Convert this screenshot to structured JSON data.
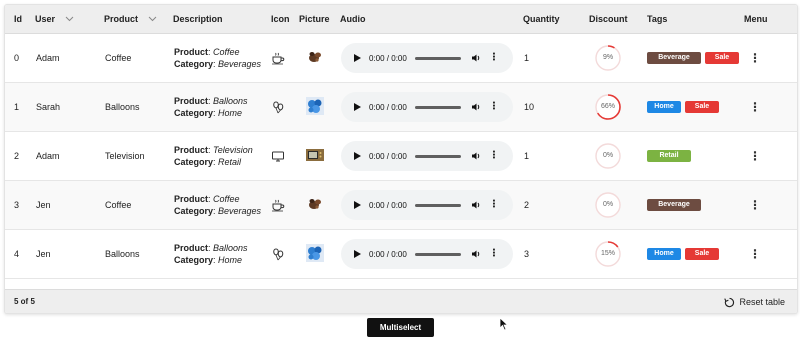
{
  "headers": {
    "id": "Id",
    "user": "User",
    "product": "Product",
    "description": "Description",
    "icon": "Icon",
    "picture": "Picture",
    "audio": "Audio",
    "quantity": "Quantity",
    "discount": "Discount",
    "tags": "Tags",
    "menu": "Menu"
  },
  "desc_labels": {
    "product": "Product",
    "category": "Category"
  },
  "rows": [
    {
      "id": "0",
      "user": "Adam",
      "product": "Coffee",
      "desc_product": "Coffee",
      "desc_category": "Beverages",
      "icon": "coffee-cup-icon",
      "audio_time": "0:00 / 0:00",
      "quantity": "1",
      "discount": 0.09,
      "discount_label": "9%",
      "tags": [
        {
          "label": "Beverage",
          "color": "#6d4c41"
        },
        {
          "label": "Sale",
          "color": "#e53935"
        }
      ]
    },
    {
      "id": "1",
      "user": "Sarah",
      "product": "Balloons",
      "desc_product": "Balloons",
      "desc_category": "Home",
      "icon": "balloons-icon",
      "audio_time": "0:00 / 0:00",
      "quantity": "10",
      "discount": 0.66,
      "discount_label": "66%",
      "tags": [
        {
          "label": "Home",
          "color": "#1e88e5"
        },
        {
          "label": "Sale",
          "color": "#e53935"
        }
      ]
    },
    {
      "id": "2",
      "user": "Adam",
      "product": "Television",
      "desc_product": "Television",
      "desc_category": "Retail",
      "icon": "television-icon",
      "audio_time": "0:00 / 0:00",
      "quantity": "1",
      "discount": 0,
      "discount_label": "0%",
      "tags": [
        {
          "label": "Retail",
          "color": "#7cb342"
        }
      ]
    },
    {
      "id": "3",
      "user": "Jen",
      "product": "Coffee",
      "desc_product": "Coffee",
      "desc_category": "Beverages",
      "icon": "coffee-cup-icon",
      "audio_time": "0:00 / 0:00",
      "quantity": "2",
      "discount": 0,
      "discount_label": "0%",
      "tags": [
        {
          "label": "Beverage",
          "color": "#6d4c41"
        }
      ]
    },
    {
      "id": "4",
      "user": "Jen",
      "product": "Balloons",
      "desc_product": "Balloons",
      "desc_category": "Home",
      "icon": "balloons-icon",
      "audio_time": "0:00 / 0:00",
      "quantity": "3",
      "discount": 0.15,
      "discount_label": "15%",
      "tags": [
        {
          "label": "Home",
          "color": "#1e88e5"
        },
        {
          "label": "Sale",
          "color": "#e53935"
        }
      ]
    }
  ],
  "footer": {
    "count": "5 of 5",
    "reset_label": "Reset table"
  },
  "multiselect_label": "Multiselect",
  "colors": {
    "header_bg": "#eeeeee",
    "ring_accent": "#e53935",
    "ring_track": "#f3dada"
  }
}
